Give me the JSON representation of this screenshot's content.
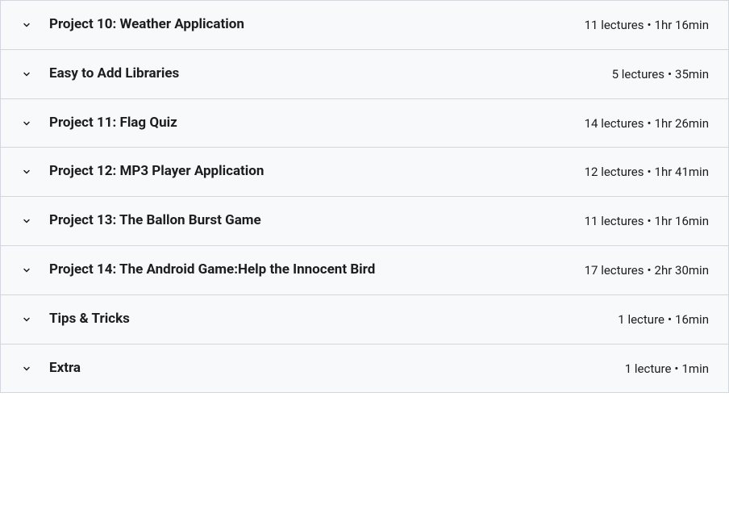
{
  "sections": [
    {
      "title": "Project 10: Weather Application",
      "lectures_label": "11 lectures",
      "duration_label": "1hr 16min"
    },
    {
      "title": "Easy to Add Libraries",
      "lectures_label": "5 lectures",
      "duration_label": "35min"
    },
    {
      "title": "Project 11: Flag Quiz",
      "lectures_label": "14 lectures",
      "duration_label": "1hr 26min"
    },
    {
      "title": "Project 12: MP3 Player Application",
      "lectures_label": "12 lectures",
      "duration_label": "1hr 41min"
    },
    {
      "title": "Project 13: The Ballon Burst Game",
      "lectures_label": "11 lectures",
      "duration_label": "1hr 16min"
    },
    {
      "title": "Project 14: The Android Game:Help the Innocent Bird",
      "lectures_label": "17 lectures",
      "duration_label": "2hr 30min"
    },
    {
      "title": "Tips & Tricks",
      "lectures_label": "1 lecture",
      "duration_label": "16min"
    },
    {
      "title": "Extra",
      "lectures_label": "1 lecture",
      "duration_label": "1min"
    }
  ],
  "separator": "•"
}
